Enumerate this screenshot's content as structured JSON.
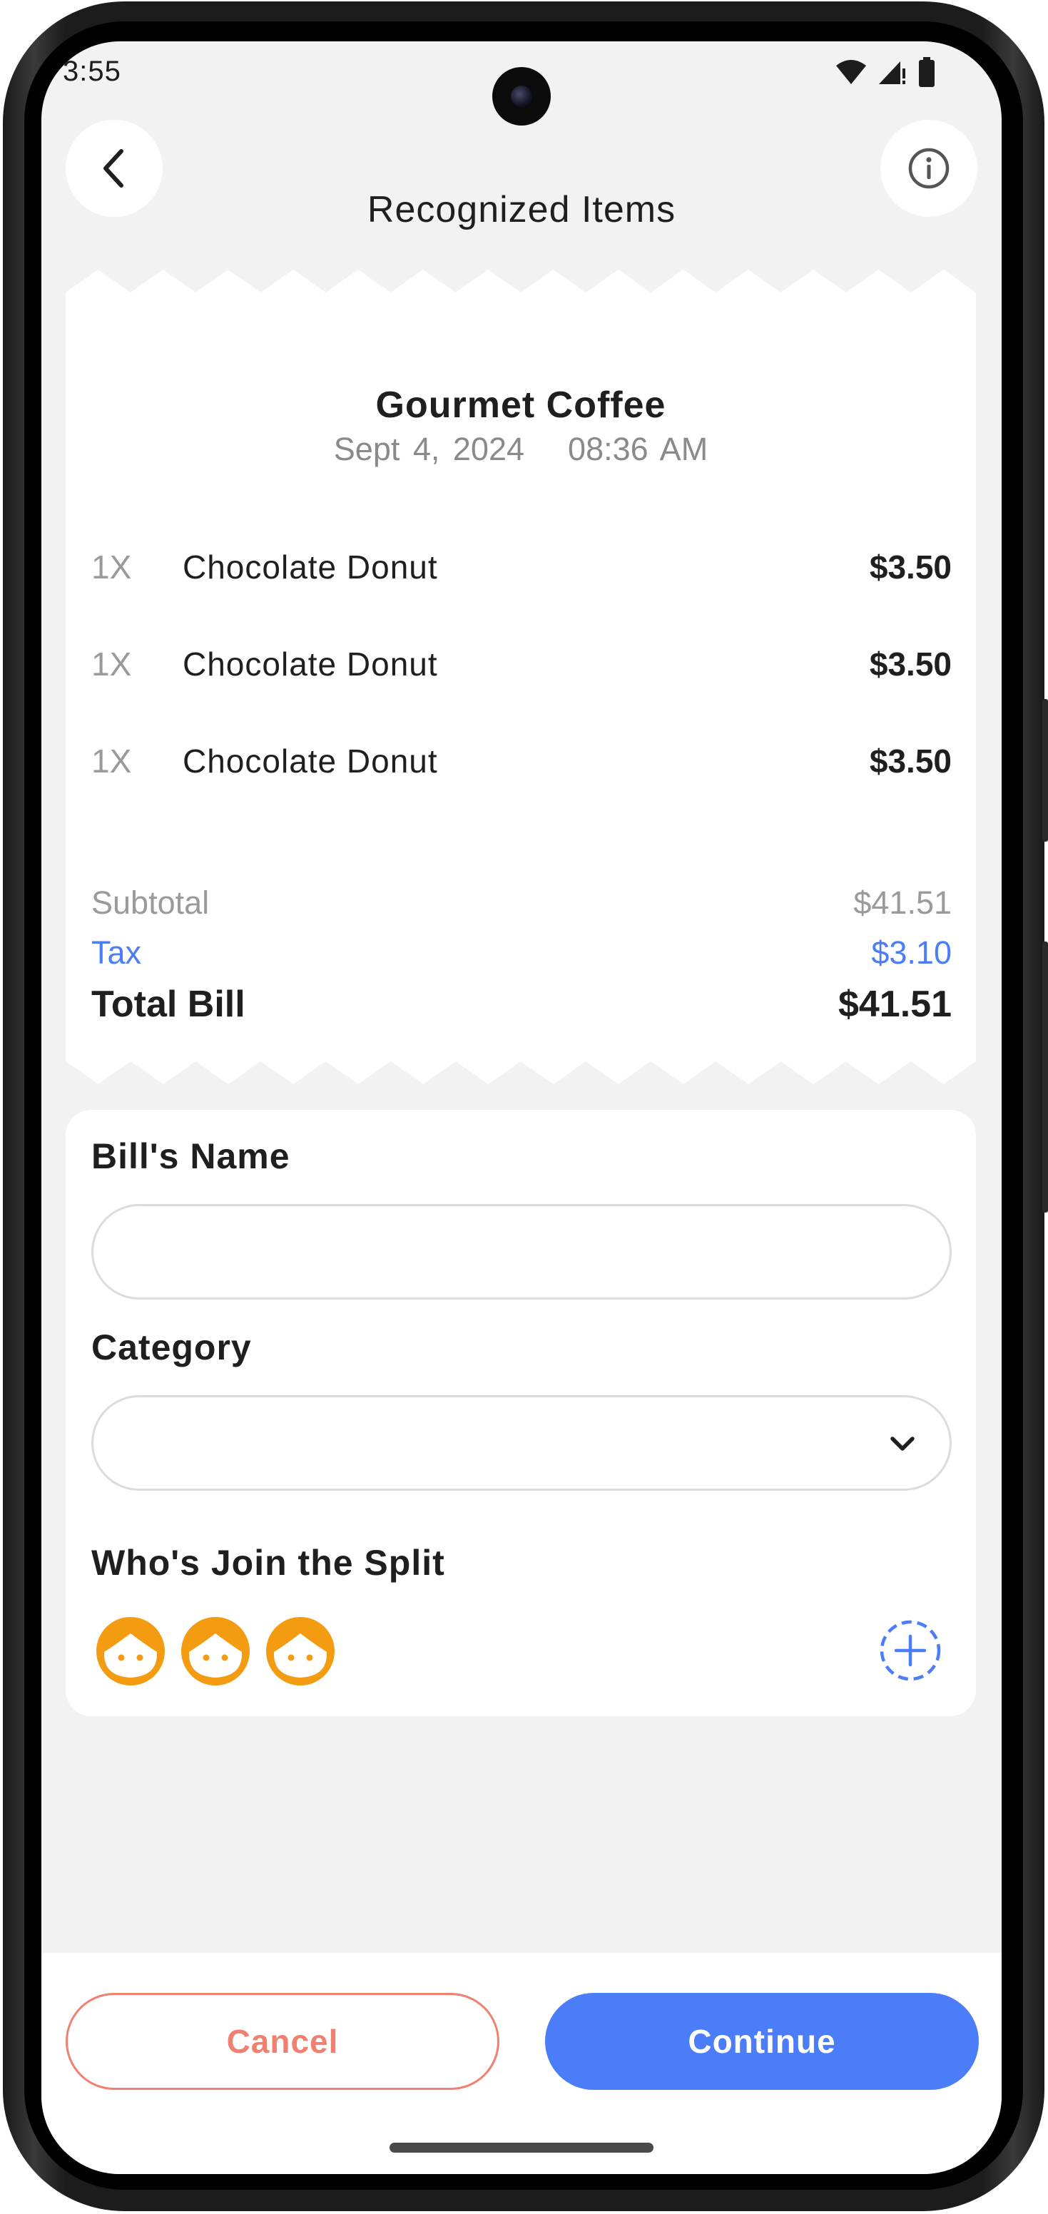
{
  "status_bar": {
    "time": "3:55"
  },
  "header": {
    "title": "Recognized Items",
    "back_icon": "chevron-left-icon",
    "info_icon": "info-icon"
  },
  "receipt": {
    "store_name": "Gourmet Coffee",
    "date": "Sept 4, 2024",
    "time": "08:36 AM",
    "items": [
      {
        "qty": "1X",
        "name": "Chocolate Donut",
        "price": "$3.50"
      },
      {
        "qty": "1X",
        "name": "Chocolate Donut",
        "price": "$3.50"
      },
      {
        "qty": "1X",
        "name": "Chocolate Donut",
        "price": "$3.50"
      }
    ],
    "subtotal_label": "Subtotal",
    "subtotal_value": "$41.51",
    "tax_label": "Tax",
    "tax_value": "$3.10",
    "total_label": "Total Bill",
    "total_value": "$41.51"
  },
  "form": {
    "bill_name_label": "Bill's Name",
    "bill_name_value": "",
    "category_label": "Category",
    "category_value": "",
    "split_label": "Who's Join the Split",
    "participants": [
      "avatar-icon",
      "avatar-icon",
      "avatar-icon"
    ],
    "add_participant_icon": "add-circle-dashed-icon"
  },
  "actions": {
    "cancel_label": "Cancel",
    "continue_label": "Continue"
  },
  "colors": {
    "accent_blue": "#4a7df7",
    "cancel_red": "#f08070",
    "avatar_orange": "#f39c12",
    "tax_blue": "#4a7df7",
    "background": "#f2f2f2"
  }
}
